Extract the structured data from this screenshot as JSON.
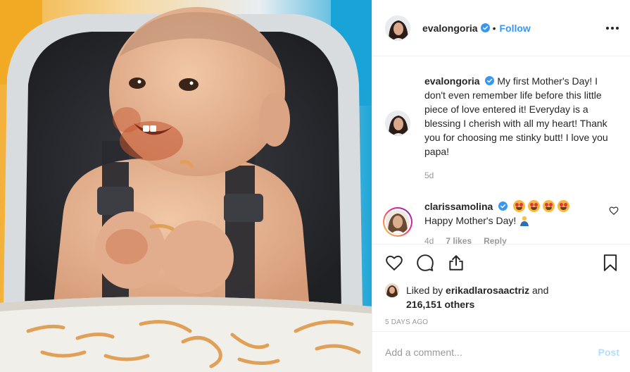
{
  "post": {
    "username": "evalongoria",
    "separator": "•",
    "follow_label": "Follow",
    "more_icon": "more-options-icon",
    "verified_icon": "verified-badge-icon"
  },
  "caption": {
    "username": "evalongoria",
    "text": "My first Mother's Day! I don't even remember life before this little piece of love entered it! Everyday is a blessing I cherish with all my heart! Thank you for choosing me stinky butt! I love you papa!",
    "time": "5d"
  },
  "reply": {
    "username": "clarissamolina",
    "emojis": [
      "heart-eyes-emoji",
      "heart-eyes-emoji",
      "heart-eyes-emoji",
      "heart-eyes-emoji"
    ],
    "text": "Happy Mother's Day!",
    "trailing_emoji": "praying-person-emoji",
    "time": "4d",
    "likes": "7 likes",
    "reply_label": "Reply"
  },
  "actions": {
    "icons": [
      "heart-icon",
      "comment-icon",
      "share-icon",
      "bookmark-icon"
    ]
  },
  "likes": {
    "prefix": "Liked by ",
    "liker": "erikadlarosaactriz",
    "conjunction": " and",
    "others": "216,151 others"
  },
  "date": "5 DAYS AGO",
  "comment_box": {
    "placeholder": "Add a comment...",
    "post_label": "Post"
  },
  "colors": {
    "accent": "#3897f0",
    "post_disabled": "#b2dffc",
    "muted": "#999999",
    "text": "#262626"
  }
}
